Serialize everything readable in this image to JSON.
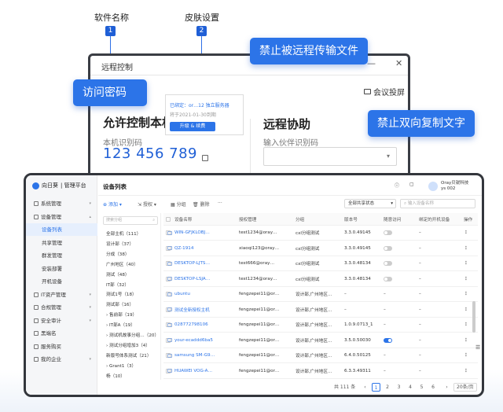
{
  "annotations": {
    "software_name": {
      "label": "软件名称",
      "number": "1"
    },
    "skin_settings": {
      "label": "皮肤设置",
      "number": "2"
    }
  },
  "callouts": {
    "no_file_transfer": "禁止被远程传输文件",
    "access_password": "访问密码",
    "no_copy_text": "禁止双向复制文字"
  },
  "remote_window": {
    "title": "远程控制",
    "minimize": "—",
    "close": "✕",
    "meeting": "会议投屏",
    "allow_section": "允许控制本机",
    "device_code_label": "本机识别码",
    "device_code": "123 456 789",
    "assist_section": "远程协助",
    "partner_input_placeholder": "输入伙伴识别码"
  },
  "popup_card": {
    "line1": "已绑定：or…12 独立服务器",
    "line2": "将于2021-01-30到期",
    "button": "升级 & 续费"
  },
  "app": {
    "brand": "向日葵",
    "brand_suffix": "| 管理平台",
    "page_title": "设备列表",
    "company": "Oray贝锐科技",
    "user": "ys            002",
    "icon_colors": {
      "accent": "#2c74e8"
    }
  },
  "sidebar": [
    {
      "label": "系统管理",
      "level": 0,
      "chev": "▾"
    },
    {
      "label": "设备管理",
      "level": 0,
      "chev": "▴"
    },
    {
      "label": "设备列表",
      "level": 1,
      "active": true
    },
    {
      "label": "共享管理",
      "level": 1
    },
    {
      "label": "群发管理",
      "level": 1
    },
    {
      "label": "安装部署",
      "level": 1
    },
    {
      "label": "开机设备",
      "level": 1
    },
    {
      "label": "IT资产管理",
      "level": 0,
      "chev": "▾"
    },
    {
      "label": "合规管理",
      "level": 0,
      "chev": "▾"
    },
    {
      "label": "安全审计",
      "level": 0,
      "chev": "▾"
    },
    {
      "label": "黑端名",
      "level": 0
    },
    {
      "label": "服务购买",
      "level": 0
    },
    {
      "label": "我的企业",
      "level": 0,
      "chev": "▾"
    }
  ],
  "toolbar": {
    "add": "添加",
    "authorize": "授权",
    "group": "分组",
    "delete": "删除",
    "more": "···",
    "share_filter": "全部共享状态",
    "search_placeholder": "输入设备名称"
  },
  "tree": {
    "search_placeholder": "搜索分组",
    "items": [
      "全部主机（111）",
      "设计部（37）",
      "分成（38）",
      "广州地区（40）",
      "测试（48）",
      "IT部（32）",
      "测试1号（18）",
      "测试部（16）",
      "› 售前部（19）",
      "› IT部A（19）",
      "› 测试机故事分组…（20）",
      "› 测试分组增加3（4）",
      "新版号体系测试（21）",
      "› Grant1（3）",
      "杨（10）"
    ]
  },
  "table": {
    "headers": [
      "设备名称",
      "授权管理",
      "分组",
      "版本号",
      "随意访问",
      "绑定的开机设备",
      "操作"
    ],
    "rows": [
      {
        "name": "WIN-GFJKLOBJ…",
        "auth": "test1234@oray…",
        "group": "cxl分组测试",
        "version": "3.3.0.49145",
        "switch": "off"
      },
      {
        "name": "QZ-1914",
        "auth": "xiaoqi123@oray…",
        "group": "cxl分组测试",
        "version": "3.3.0.49145",
        "switch": "off"
      },
      {
        "name": "DESKTOP-LJTS…",
        "auth": "test666@oray…",
        "group": "cxl分组测试",
        "version": "3.3.0.48134",
        "switch": "off"
      },
      {
        "name": "DESKTOP-LSJA…",
        "auth": "test1234@oray…",
        "group": "cxl分组测试",
        "version": "3.3.0.48134",
        "switch": "off"
      },
      {
        "name": "ubuntu",
        "auth": "fengzepei11@or…",
        "group": "设计部,广州地区…",
        "version": "–",
        "switch": "dash"
      },
      {
        "name": "测试全新授权主机",
        "auth": "fengzepei11@or…",
        "group": "设计部,广州地区…",
        "version": "–",
        "switch": "dash"
      },
      {
        "name": "028772798106",
        "auth": "fengzepei11@or…",
        "group": "设计部,广州地区…",
        "version": "1.0.9.0713_1",
        "switch": "dash"
      },
      {
        "name": "your-ecaddd6ba5",
        "auth": "fengzepei11@or…",
        "group": "设计部,广州地区…",
        "version": "3.5.0.50030",
        "switch": "on"
      },
      {
        "name": "samsung SM-G9…",
        "auth": "fengzepei11@or…",
        "group": "设计部,广州地区…",
        "version": "6.4.0.50125",
        "switch": "dash"
      },
      {
        "name": "HUAWEI VOG-A…",
        "auth": "fengzepei11@or…",
        "group": "设计部,广州地区…",
        "version": "6.3.3.49311",
        "switch": "dash"
      }
    ]
  },
  "pager": {
    "total": "共 111 条",
    "prev": "‹",
    "pages": [
      "1",
      "2",
      "3",
      "4",
      "5",
      "6"
    ],
    "next": "›",
    "page_size": "20条/页"
  }
}
